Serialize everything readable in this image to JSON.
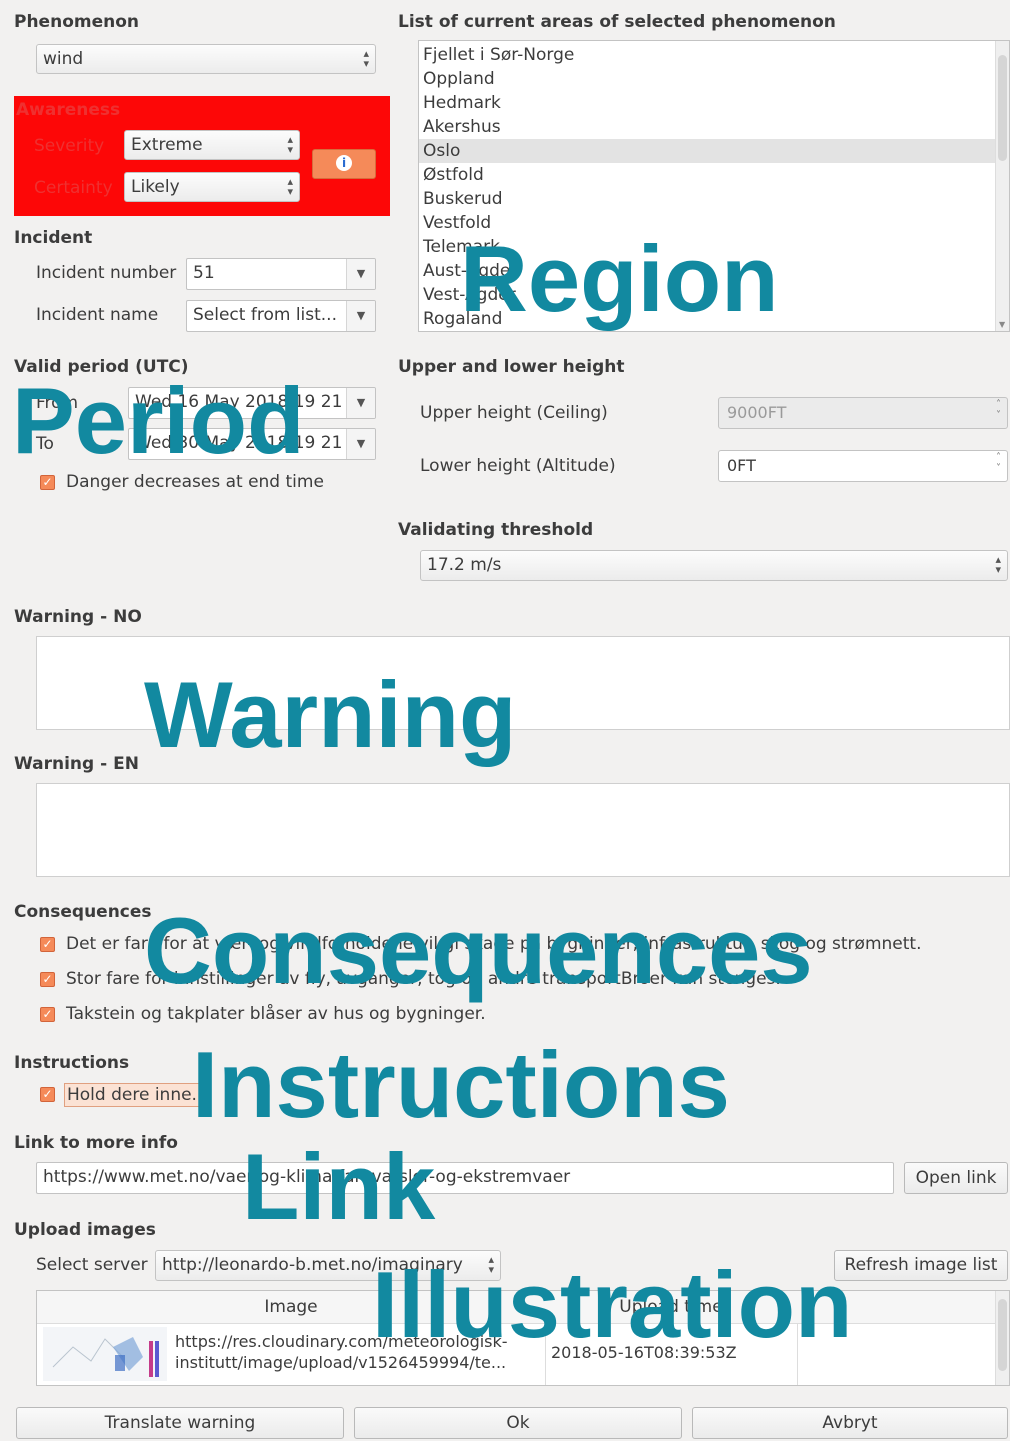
{
  "phenomenon": {
    "section": "Phenomenon",
    "value": "wind"
  },
  "awareness": {
    "section": "Awareness",
    "severity_label": "Severity",
    "severity_value": "Extreme",
    "certainty_label": "Certainty",
    "certainty_value": "Likely",
    "color": "#fd0707"
  },
  "incident": {
    "section": "Incident",
    "number_label": "Incident number",
    "number_value": "51",
    "name_label": "Incident name",
    "name_value": "Select from list..."
  },
  "areas": {
    "section": "List of current areas of selected phenomenon",
    "items": [
      "Fjellet i Sør-Norge",
      "Oppland",
      "Hedmark",
      "Akershus",
      "Oslo",
      "Østfold",
      "Buskerud",
      "Vestfold",
      "Telemark",
      "Aust-Agder",
      "Vest-Agder",
      "Rogaland"
    ],
    "selected_index": 4
  },
  "valid_period": {
    "section": "Valid period (UTC)",
    "from_label": "From",
    "from_value": "Wed 16 May 2018 19 21",
    "to_label": "To",
    "to_value": "Wed 30 May 2018 19 21",
    "danger_decreases_label": "Danger decreases at end time",
    "danger_decreases_checked": true
  },
  "height": {
    "section": "Upper and lower height",
    "upper_label": "Upper height (Ceiling)",
    "upper_value": "9000FT",
    "lower_label": "Lower height (Altitude)",
    "lower_value": "0FT"
  },
  "threshold": {
    "section": "Validating threshold",
    "value": "17.2 m/s"
  },
  "warning_no": {
    "section": "Warning - NO",
    "text": ""
  },
  "warning_en": {
    "section": "Warning - EN",
    "text": ""
  },
  "consequences": {
    "section": "Consequences",
    "items": [
      {
        "text": "Det er fare for at vær- og vindforholdene vil gi skade på bygninger, infrastruktur, skog og strømnett.",
        "checked": true
      },
      {
        "text": "Stor fare for innstillinger av fly, avganger, tog og andre transportBroer kan stenges.",
        "checked": true
      },
      {
        "text": "Takstein og takplater blåser av hus og bygninger.",
        "checked": true
      }
    ]
  },
  "instructions": {
    "section": "Instructions",
    "item": "Hold dere inne.",
    "checked": true
  },
  "link": {
    "section": "Link to more info",
    "url": "https://www.met.no/vaer-og-klima/farevarsler-og-ekstremvaer",
    "open_label": "Open link"
  },
  "upload": {
    "section": "Upload images",
    "server_label": "Select server",
    "server_value": "http://leonardo-b.met.no/imaginary",
    "refresh_label": "Refresh image list",
    "col_image": "Image",
    "col_upload_time": "Upload time",
    "row_url_1": "https://res.cloudinary.com/meteorologisk-",
    "row_url_2": "institutt/image/upload/v1526459994/te...",
    "row_time": "2018-05-16T08:39:53Z"
  },
  "buttons": {
    "translate": "Translate warning",
    "ok": "Ok",
    "cancel": "Avbryt"
  },
  "overlay_labels": {
    "region": "Region",
    "period": "Period",
    "warning": "Warning",
    "consequences": "Consequences",
    "instructions": "Instructions",
    "link": "Link",
    "illustration": "Illustration"
  },
  "colors": {
    "accent_orange": "#f58a59",
    "overlay_teal": "#1289a0",
    "awareness_red": "#fd0707"
  }
}
